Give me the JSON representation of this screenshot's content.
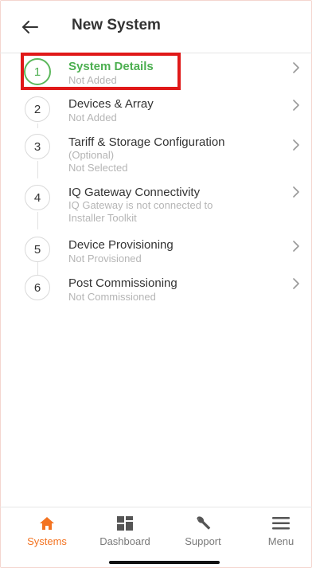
{
  "header": {
    "title": "New System",
    "back_icon": "arrow-left-icon"
  },
  "steps": [
    {
      "number": "1",
      "title": "System Details",
      "subtitle": "Not Added",
      "active": true
    },
    {
      "number": "2",
      "title": "Devices & Array",
      "subtitle": "Not Added"
    },
    {
      "number": "3",
      "title": "Tariff & Storage Configuration",
      "subtitle": "(Optional)",
      "status": "Not Selected"
    },
    {
      "number": "4",
      "title": "IQ Gateway Connectivity",
      "subtitle": "IQ Gateway is not connected to",
      "subtitle_line2": "Installer Toolkit"
    },
    {
      "number": "5",
      "title": "Device Provisioning",
      "subtitle": "Not Provisioned"
    },
    {
      "number": "6",
      "title": "Post Commissioning",
      "subtitle": "Not Commissioned"
    }
  ],
  "tabbar": {
    "items": [
      {
        "label": "Systems",
        "icon": "home-icon",
        "active": true
      },
      {
        "label": "Dashboard",
        "icon": "dashboard-grid-icon"
      },
      {
        "label": "Support",
        "icon": "wrench-icon"
      },
      {
        "label": "Menu",
        "icon": "hamburger-menu-icon"
      }
    ]
  },
  "colors": {
    "active_step": "#4caf50",
    "highlight_border": "#e01919",
    "active_tab": "#f37321",
    "muted_text": "#b5b5b5"
  }
}
